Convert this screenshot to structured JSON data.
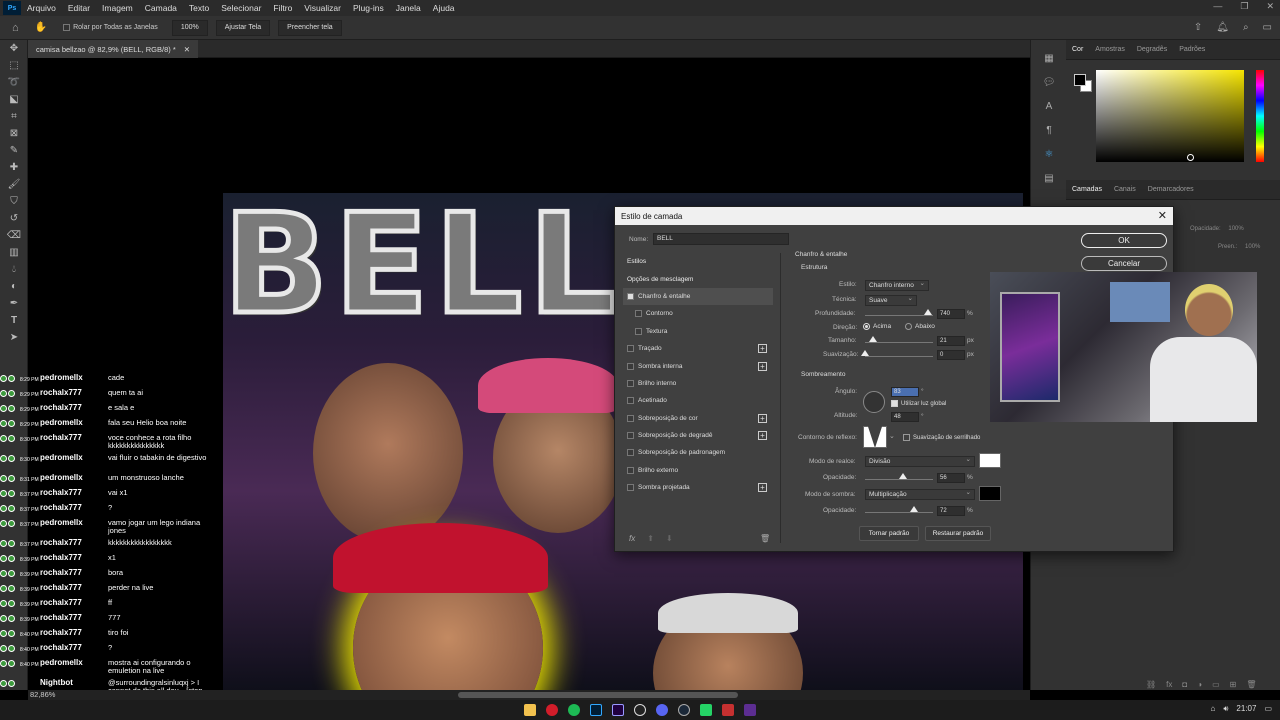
{
  "menubar": {
    "app_logo": "Ps",
    "items": [
      "Arquivo",
      "Editar",
      "Imagem",
      "Camada",
      "Texto",
      "Selecionar",
      "Filtro",
      "Visualizar",
      "Plug-ins",
      "Janela",
      "Ajuda"
    ]
  },
  "options": {
    "scroll_all_label": "Rolar por Todas as Janelas",
    "zoom_100": "100%",
    "fit_screen": "Ajustar Tela",
    "fill_screen": "Preencher tela"
  },
  "document": {
    "tab_title": "camisa bellzao @ 82,9% (BELL, RGB/8) *",
    "canvas_text": "BELL",
    "zoom_status": "82,86%"
  },
  "panels": {
    "color_tabs": [
      "Cor",
      "Amostras",
      "Degradês",
      "Padrões"
    ],
    "layer_tabs": [
      "Camadas",
      "Canais",
      "Demarcadores"
    ],
    "layers_opacity_label": "Opacidade:",
    "layers_opacity_value": "100%",
    "layers_fill_label": "Preen.:",
    "layers_fill_value": "100%",
    "fg_color": "#000000",
    "bg_color": "#ffffff"
  },
  "dialog": {
    "title": "Estilo de camada",
    "name_label": "Nome:",
    "name_value": "BELL",
    "ok": "OK",
    "cancel": "Cancelar",
    "styles": [
      {
        "label": "Estilos",
        "kind": "section"
      },
      {
        "label": "Opções de mesclagem",
        "kind": "section"
      },
      {
        "label": "Chanfro & entalhe",
        "checked": true,
        "active": true
      },
      {
        "label": "Contorno",
        "checked": false,
        "indent": true
      },
      {
        "label": "Textura",
        "checked": false,
        "indent": true
      },
      {
        "label": "Traçado",
        "checked": false,
        "plus": true
      },
      {
        "label": "Sombra interna",
        "checked": false,
        "plus": true
      },
      {
        "label": "Brilho interno",
        "checked": false
      },
      {
        "label": "Acetinado",
        "checked": false
      },
      {
        "label": "Sobreposição de cor",
        "checked": false,
        "plus": true
      },
      {
        "label": "Sobreposição de degradê",
        "checked": false,
        "plus": true
      },
      {
        "label": "Sobreposição de padronagem",
        "checked": false
      },
      {
        "label": "Brilho externo",
        "checked": false
      },
      {
        "label": "Sombra projetada",
        "checked": false,
        "plus": true
      }
    ],
    "fx_label": "fx",
    "bevel": {
      "heading": "Chanfro & entalhe",
      "structure_heading": "Estrutura",
      "style_label": "Estilo:",
      "style_value": "Chanfro interno",
      "technique_label": "Técnica:",
      "technique_value": "Suave",
      "depth_label": "Profundidade:",
      "depth_value": "740",
      "depth_unit": "%",
      "depth_slider_pct": 0.92,
      "direction_label": "Direção:",
      "dir_up": "Acima",
      "dir_down": "Abaixo",
      "size_label": "Tamanho:",
      "size_value": "21",
      "size_unit": "px",
      "size_slider_pct": 0.12,
      "soften_label": "Suavização:",
      "soften_value": "0",
      "soften_unit": "px",
      "soften_slider_pct": 0.0,
      "shading_heading": "Sombreamento",
      "angle_label": "Ângulo:",
      "angle_value": "83",
      "angle_unit": "°",
      "global_light_label": "Utilizar luz global",
      "altitude_label": "Altitude:",
      "altitude_value": "48",
      "altitude_unit": "°",
      "gloss_label": "Contorno de reflexo:",
      "antialias_label": "Suavização de serrilhado",
      "highlight_mode_label": "Modo de realce:",
      "highlight_mode_value": "Divisão",
      "highlight_color": "#ffffff",
      "highlight_opacity_label": "Opacidade:",
      "highlight_opacity_value": "56",
      "highlight_opacity_unit": "%",
      "highlight_opacity_pct": 0.56,
      "shadow_mode_label": "Modo de sombra:",
      "shadow_mode_value": "Multiplicação",
      "shadow_color": "#000000",
      "shadow_opacity_label": "Opacidade:",
      "shadow_opacity_value": "72",
      "shadow_opacity_unit": "%",
      "shadow_opacity_pct": 0.72,
      "make_default": "Tornar padrão",
      "reset_default": "Restaurar padrão"
    }
  },
  "chat": [
    {
      "time": "8:29 PM",
      "user": "pedromellx",
      "msg": "cade"
    },
    {
      "time": "8:29 PM",
      "user": "rochalx777",
      "msg": "quem ta ai"
    },
    {
      "time": "8:29 PM",
      "user": "rochalx777",
      "msg": "e sala e"
    },
    {
      "time": "8:29 PM",
      "user": "pedromellx",
      "msg": "fala seu Helio boa noite"
    },
    {
      "time": "8:30 PM",
      "user": "rochalx777",
      "msg": "voce conhece a rota filho kkkkkkkkkkkkkkk"
    },
    {
      "time": "8:30 PM",
      "user": "pedromellx",
      "msg": "vai fluir o tabakin de digestivo"
    },
    {
      "time": "8:31 PM",
      "user": "pedromellx",
      "msg": "um monstruoso lanche"
    },
    {
      "time": "8:37 PM",
      "user": "rochalx777",
      "msg": "vai x1"
    },
    {
      "time": "8:37 PM",
      "user": "rochalx777",
      "msg": "?"
    },
    {
      "time": "8:37 PM",
      "user": "pedromellx",
      "msg": "vamo jogar um lego indiana jones"
    },
    {
      "time": "8:37 PM",
      "user": "rochalx777",
      "msg": "kkkkkkkkkkkkkkkkk"
    },
    {
      "time": "8:39 PM",
      "user": "rochalx777",
      "msg": "x1"
    },
    {
      "time": "8:39 PM",
      "user": "rochalx777",
      "msg": "bora"
    },
    {
      "time": "8:39 PM",
      "user": "rochalx777",
      "msg": "perder na live"
    },
    {
      "time": "8:39 PM",
      "user": "rochalx777",
      "msg": "ff"
    },
    {
      "time": "8:39 PM",
      "user": "rochalx777",
      "msg": "777"
    },
    {
      "time": "8:40 PM",
      "user": "rochalx777",
      "msg": "tiro foi"
    },
    {
      "time": "8:40 PM",
      "user": "rochalx777",
      "msg": "?"
    },
    {
      "time": "8:40 PM",
      "user": "pedromellx",
      "msg": "mostra ai configurando o emuletion na live"
    },
    {
      "time": "",
      "user": "Nightbot",
      "msg": "@surroundingralsinluqxj > I cannot do this all day... [stop posting links] [warning]"
    }
  ],
  "taskbar": {
    "time": "21:07"
  }
}
